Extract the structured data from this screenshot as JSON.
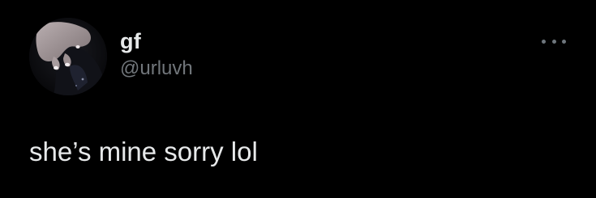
{
  "user": {
    "display_name": "gf",
    "handle": "@urluvh"
  },
  "tweet": {
    "text": "she’s mine sorry lol"
  },
  "icons": {
    "more": "more-horizontal-icon"
  },
  "colors": {
    "background": "#000000",
    "primary_text": "#e7e9ea",
    "secondary_text": "#71767b"
  }
}
